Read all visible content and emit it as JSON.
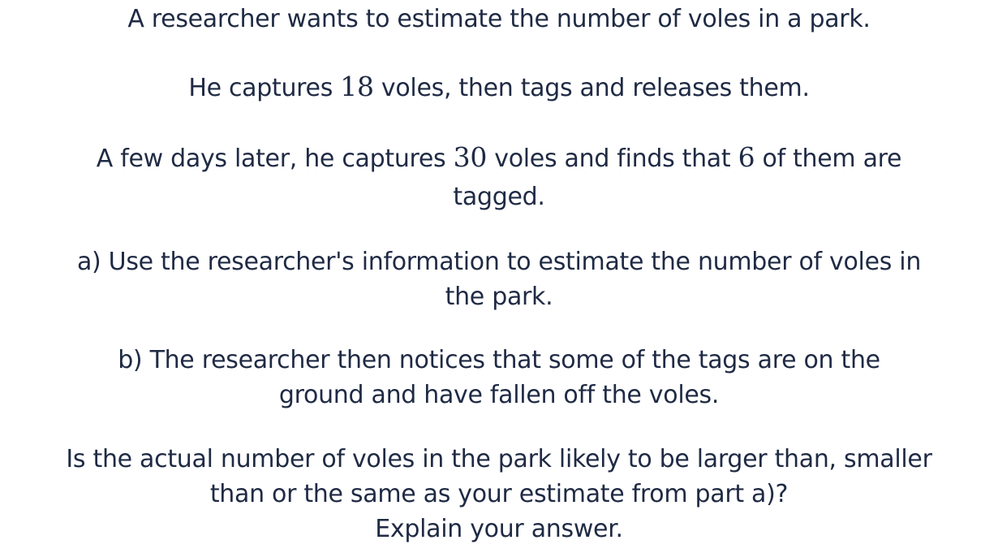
{
  "question": {
    "intro": "A researcher wants to estimate the number of voles in a park.",
    "capture1": {
      "before": "He captures ",
      "number": "18",
      "after": " voles, then tags and releases them."
    },
    "capture2": {
      "before": "A few days later, he captures ",
      "number1": "30",
      "middle": " voles and finds that ",
      "number2": "6",
      "after": " of them are",
      "line2": "tagged."
    },
    "part_a": {
      "line1": "a) Use the researcher's information to estimate the number of voles in",
      "line2": "the park."
    },
    "part_b": {
      "line1": "b) The researcher then notices that some of the tags are on the",
      "line2": "ground and have fallen off the voles."
    },
    "part_b_question": {
      "line1": "Is the actual number of voles in the park likely to be larger than, smaller",
      "line2": "than or the same as your estimate from part a)?",
      "line3": "Explain your answer."
    }
  }
}
